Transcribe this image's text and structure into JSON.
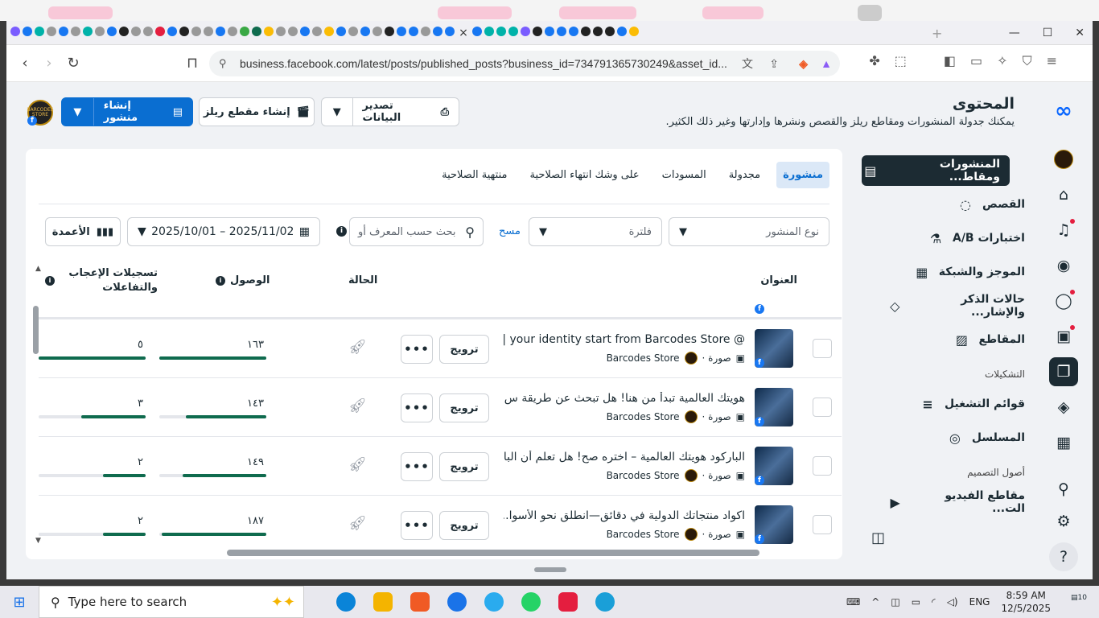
{
  "browser": {
    "url": "business.facebook.com/latest/posts/published_posts?business_id=734791365730249&asset_id...",
    "close_tab": "×",
    "new_tab": "+",
    "minimize": "—",
    "maximize": "☐",
    "close": "✕"
  },
  "header": {
    "title": "المحتوى",
    "subtitle": "يمكنك جدولة المنشورات ومقاطع ريلز والقصص ونشرها وإدارتها وغير ذلك الكثير.",
    "export_label": "تصدير البيانات",
    "create_reel_label": "إنشاء مقطع ريلز",
    "create_post_label": "إنشاء منشور",
    "avatar_text": "BARCODES STORE"
  },
  "sidenav": {
    "items": [
      {
        "label": "المنشورات ومقاط...",
        "icon": "▤"
      },
      {
        "label": "القصص",
        "icon": "◌"
      },
      {
        "label": "اختبارات A/B",
        "icon": "⚗"
      },
      {
        "label": "الموجز والشبكة",
        "icon": "▦"
      },
      {
        "label": "حالات الذكر والإشار...",
        "icon": "◇"
      },
      {
        "label": "المقاطع",
        "icon": "▨"
      }
    ],
    "section_playlists": "التشكيلات",
    "playlists": [
      {
        "label": "قوائم التشغيل",
        "icon": "≡"
      },
      {
        "label": "المسلسل",
        "icon": "◎"
      }
    ],
    "section_assets": "أصول التصميم",
    "assets": [
      {
        "label": "مقاطع الفيديو الت...",
        "icon": "▶"
      }
    ],
    "collapse_icon": "◫"
  },
  "tabs": [
    "منشورة",
    "مجدولة",
    "المسودات",
    "على وشك انتهاء الصلاحية",
    "منتهية الصلاحية"
  ],
  "filters": {
    "post_type": "نوع المنشور",
    "filter": "فلترة",
    "clear": "مسح",
    "search_placeholder": "بحث حسب المعرف أو",
    "date_range": "2025/10/01 – 2025/11/02",
    "columns": "الأعمدة"
  },
  "table": {
    "col_title": "العنوان",
    "col_status": "الحالة",
    "col_reach": "الوصول",
    "col_engagement": "تسجيلات الإعجاب والتفاعلات",
    "rows": [
      {
        "title": "@ your identity start from Barcodes Store | با...",
        "type": "صورة ·",
        "page": "Barcodes Store",
        "promote": "ترويج",
        "reach": "١٦٣",
        "reach_pct": 100,
        "eng": "٥",
        "eng_pct": 100
      },
      {
        "title": "هويتك العالمية تبدأ من هنا! هل تبحث عن طريقة س...",
        "type": "صورة ·",
        "page": "Barcodes Store",
        "promote": "ترويج",
        "reach": "١٤٣",
        "reach_pct": 75,
        "eng": "٣",
        "eng_pct": 60
      },
      {
        "title": "الباركود هويتك العالمية – اختره صح! هل تعلم أن البا...",
        "type": "صورة ·",
        "page": "Barcodes Store",
        "promote": "ترويج",
        "reach": "١٤٩",
        "reach_pct": 78,
        "eng": "٢",
        "eng_pct": 40
      },
      {
        "title": "اكواد منتجاتك الدولية في دقائق—انطلق نحو الأسوا...",
        "type": "صورة ·",
        "page": "Barcodes Store",
        "promote": "ترويج",
        "reach": "١٨٧",
        "reach_pct": 98,
        "eng": "٢",
        "eng_pct": 40
      }
    ]
  },
  "taskbar": {
    "search_placeholder": "Type here to search",
    "lang": "ENG",
    "time": "8:59 AM",
    "date": "12/5/2025",
    "notif_count": "10"
  }
}
